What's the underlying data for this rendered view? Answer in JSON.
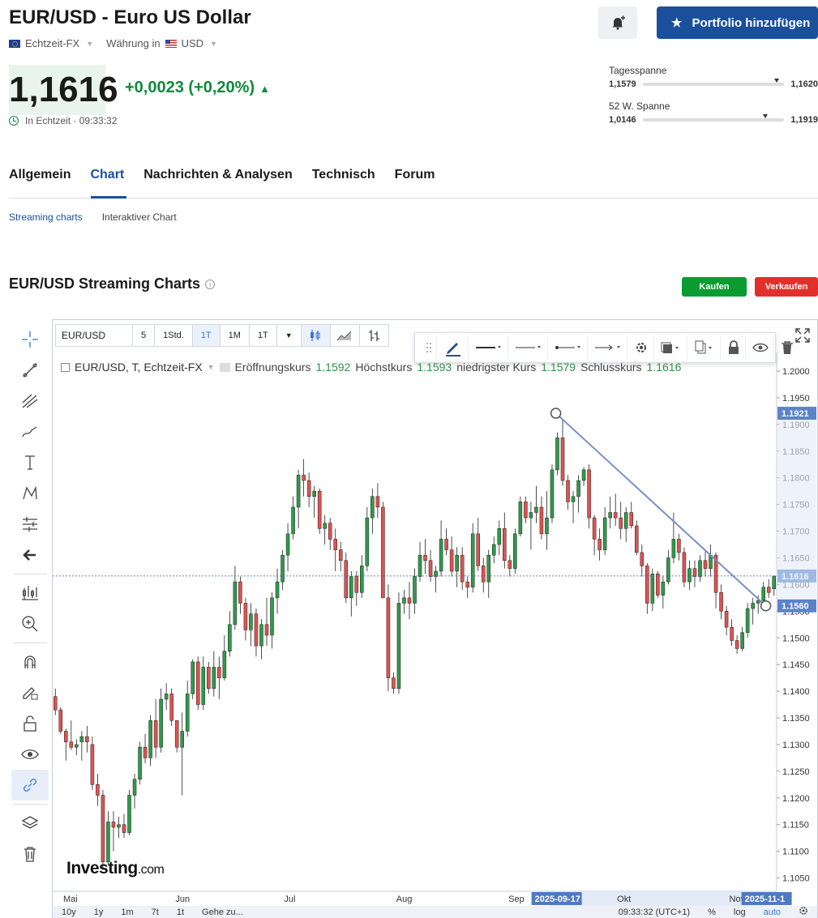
{
  "header": {
    "title": "EUR/USD - Euro US Dollar",
    "feed": "Echtzeit-FX",
    "currency_label": "Währung in",
    "currency": "USD",
    "price": "1,1616",
    "change": "+0,0023 (+0,20%)",
    "realtime_label": "In Echtzeit · 09:33:32",
    "portfolio_button": "Portfolio hinzufügen",
    "day_range": {
      "label": "Tagesspanne",
      "low": "1,1579",
      "high": "1,1620",
      "position": 0.93
    },
    "week52_range": {
      "label": "52 W. Spanne",
      "low": "1,0146",
      "high": "1,1919",
      "position": 0.85
    }
  },
  "tabs": [
    "Allgemein",
    "Chart",
    "Nachrichten & Analysen",
    "Technisch",
    "Forum"
  ],
  "active_tab": "Chart",
  "subtabs": [
    "Streaming charts",
    "Interaktiver Chart"
  ],
  "section_title": "EUR/USD Streaming Charts",
  "buttons": {
    "buy": "Kaufen",
    "sell": "Verkaufen"
  },
  "chart_toolbar": {
    "symbol": "EUR/USD",
    "intervals": [
      "5",
      "1Std.",
      "1T",
      "1M",
      "1T"
    ],
    "active_interval": "1T"
  },
  "legend": {
    "symbol": "EUR/USD, T, Echtzeit-FX",
    "open_label": "Eröffnungskurs",
    "open": "1.1592",
    "high_label": "Höchstkurs",
    "high": "1.1593",
    "low_label": "niedrigster Kurs",
    "low": "1.1579",
    "close_label": "Schlusskurs",
    "close": "1.1616"
  },
  "watermark": {
    "brand": "Investing",
    "suffix": ".com"
  },
  "bottom_bar": {
    "ranges": [
      "10y",
      "1y",
      "1m",
      "7t",
      "1t",
      "Gehe zu..."
    ],
    "time": "09:33:32 (UTC+1)",
    "options": [
      "%",
      "log",
      "auto"
    ]
  },
  "colors": {
    "up": "#2f9a4a",
    "down": "#e0524f",
    "brand_blue": "#1a4f9c",
    "trendline": "#7a8fc4",
    "positive": "#0f8a3b"
  },
  "chart_data": {
    "type": "candlestick",
    "y_ticks": [
      "1.2000",
      "1.1950",
      "1.1900",
      "1.1850",
      "1.1800",
      "1.1750",
      "1.1700",
      "1.1650",
      "1.1600",
      "1.1550",
      "1.1500",
      "1.1450",
      "1.1400",
      "1.1350",
      "1.1300",
      "1.1250",
      "1.1200",
      "1.1150",
      "1.1100",
      "1.1050"
    ],
    "ylim": [
      1.1025,
      1.2035
    ],
    "x_labels": [
      "Mai",
      "Jun",
      "Jul",
      "Aug",
      "Sep",
      "Okt",
      "Nov"
    ],
    "x_label_days": [
      0,
      31,
      61,
      92,
      123,
      153,
      184
    ],
    "x_range_days": [
      0,
      200
    ],
    "price_tags": [
      {
        "value": 1.1921,
        "label": "1.1921"
      },
      {
        "value": 1.1616,
        "label": "1.1616"
      },
      {
        "value": 1.156,
        "label": "1.1560"
      }
    ],
    "date_tags": [
      {
        "day": 139,
        "label": "2025-09-17"
      },
      {
        "day": 197,
        "label": "2025-11-1"
      }
    ],
    "last_price": 1.1616,
    "trendline": {
      "from": {
        "day": 139,
        "value": 1.1921
      },
      "to": {
        "day": 197,
        "value": 1.156
      }
    },
    "candles": [
      {
        "o": 1.139,
        "h": 1.1405,
        "l": 1.1355,
        "c": 1.1365
      },
      {
        "o": 1.1365,
        "h": 1.137,
        "l": 1.132,
        "c": 1.1325
      },
      {
        "o": 1.1325,
        "h": 1.133,
        "l": 1.127,
        "c": 1.1305
      },
      {
        "o": 1.1305,
        "h": 1.1345,
        "l": 1.129,
        "c": 1.1295
      },
      {
        "o": 1.1295,
        "h": 1.131,
        "l": 1.128,
        "c": 1.13
      },
      {
        "o": 1.1305,
        "h": 1.1325,
        "l": 1.127,
        "c": 1.1315
      },
      {
        "o": 1.1315,
        "h": 1.1335,
        "l": 1.1285,
        "c": 1.1305
      },
      {
        "o": 1.13,
        "h": 1.1315,
        "l": 1.1215,
        "c": 1.1225
      },
      {
        "o": 1.1225,
        "h": 1.1245,
        "l": 1.1185,
        "c": 1.1205
      },
      {
        "o": 1.1205,
        "h": 1.1215,
        "l": 1.1065,
        "c": 1.108
      },
      {
        "o": 1.108,
        "h": 1.1175,
        "l": 1.1075,
        "c": 1.1155
      },
      {
        "o": 1.1155,
        "h": 1.1175,
        "l": 1.11,
        "c": 1.1145
      },
      {
        "o": 1.1145,
        "h": 1.1165,
        "l": 1.1125,
        "c": 1.115
      },
      {
        "o": 1.115,
        "h": 1.117,
        "l": 1.1125,
        "c": 1.1135
      },
      {
        "o": 1.1135,
        "h": 1.1215,
        "l": 1.113,
        "c": 1.1205
      },
      {
        "o": 1.1205,
        "h": 1.1245,
        "l": 1.118,
        "c": 1.1235
      },
      {
        "o": 1.1235,
        "h": 1.1305,
        "l": 1.1225,
        "c": 1.1295
      },
      {
        "o": 1.1295,
        "h": 1.132,
        "l": 1.1265,
        "c": 1.1275
      },
      {
        "o": 1.1275,
        "h": 1.1355,
        "l": 1.126,
        "c": 1.1345
      },
      {
        "o": 1.1345,
        "h": 1.1385,
        "l": 1.1275,
        "c": 1.1295
      },
      {
        "o": 1.1295,
        "h": 1.1405,
        "l": 1.1285,
        "c": 1.1385
      },
      {
        "o": 1.1385,
        "h": 1.1415,
        "l": 1.1365,
        "c": 1.1395
      },
      {
        "o": 1.1395,
        "h": 1.1405,
        "l": 1.1335,
        "c": 1.1345
      },
      {
        "o": 1.1345,
        "h": 1.1335,
        "l": 1.1285,
        "c": 1.1295
      },
      {
        "o": 1.1295,
        "h": 1.136,
        "l": 1.1205,
        "c": 1.1325
      },
      {
        "o": 1.1325,
        "h": 1.142,
        "l": 1.1315,
        "c": 1.1395
      },
      {
        "o": 1.1395,
        "h": 1.146,
        "l": 1.1385,
        "c": 1.1455
      },
      {
        "o": 1.1455,
        "h": 1.1465,
        "l": 1.1365,
        "c": 1.1375
      },
      {
        "o": 1.1375,
        "h": 1.1465,
        "l": 1.1365,
        "c": 1.1445
      },
      {
        "o": 1.1445,
        "h": 1.1455,
        "l": 1.1395,
        "c": 1.1405
      },
      {
        "o": 1.1405,
        "h": 1.1475,
        "l": 1.139,
        "c": 1.1445
      },
      {
        "o": 1.1445,
        "h": 1.1465,
        "l": 1.1385,
        "c": 1.1425
      },
      {
        "o": 1.1425,
        "h": 1.1505,
        "l": 1.142,
        "c": 1.1475
      },
      {
        "o": 1.1475,
        "h": 1.155,
        "l": 1.1465,
        "c": 1.1525
      },
      {
        "o": 1.1525,
        "h": 1.1635,
        "l": 1.1515,
        "c": 1.1605
      },
      {
        "o": 1.1605,
        "h": 1.1615,
        "l": 1.1545,
        "c": 1.1565
      },
      {
        "o": 1.1565,
        "h": 1.1575,
        "l": 1.1495,
        "c": 1.1515
      },
      {
        "o": 1.1515,
        "h": 1.1565,
        "l": 1.1485,
        "c": 1.1545
      },
      {
        "o": 1.1545,
        "h": 1.1555,
        "l": 1.1465,
        "c": 1.1485
      },
      {
        "o": 1.1485,
        "h": 1.1535,
        "l": 1.146,
        "c": 1.1525
      },
      {
        "o": 1.1525,
        "h": 1.1575,
        "l": 1.1485,
        "c": 1.1505
      },
      {
        "o": 1.1505,
        "h": 1.1585,
        "l": 1.148,
        "c": 1.1575
      },
      {
        "o": 1.1575,
        "h": 1.163,
        "l": 1.1545,
        "c": 1.1605
      },
      {
        "o": 1.1605,
        "h": 1.1665,
        "l": 1.159,
        "c": 1.1655
      },
      {
        "o": 1.1655,
        "h": 1.1715,
        "l": 1.1625,
        "c": 1.1695
      },
      {
        "o": 1.1695,
        "h": 1.1765,
        "l": 1.1685,
        "c": 1.1745
      },
      {
        "o": 1.1745,
        "h": 1.1815,
        "l": 1.1705,
        "c": 1.1805
      },
      {
        "o": 1.1805,
        "h": 1.1835,
        "l": 1.1765,
        "c": 1.1795
      },
      {
        "o": 1.1795,
        "h": 1.181,
        "l": 1.1745,
        "c": 1.1765
      },
      {
        "o": 1.1765,
        "h": 1.1785,
        "l": 1.1725,
        "c": 1.1775
      },
      {
        "o": 1.1775,
        "h": 1.178,
        "l": 1.1695,
        "c": 1.1705
      },
      {
        "o": 1.1705,
        "h": 1.173,
        "l": 1.1675,
        "c": 1.1715
      },
      {
        "o": 1.1715,
        "h": 1.1725,
        "l": 1.1665,
        "c": 1.1685
      },
      {
        "o": 1.1685,
        "h": 1.1705,
        "l": 1.1625,
        "c": 1.1665
      },
      {
        "o": 1.1665,
        "h": 1.168,
        "l": 1.1625,
        "c": 1.1645
      },
      {
        "o": 1.1645,
        "h": 1.166,
        "l": 1.1565,
        "c": 1.1575
      },
      {
        "o": 1.1575,
        "h": 1.1625,
        "l": 1.154,
        "c": 1.1615
      },
      {
        "o": 1.1615,
        "h": 1.1625,
        "l": 1.156,
        "c": 1.1585
      },
      {
        "o": 1.1585,
        "h": 1.1655,
        "l": 1.1575,
        "c": 1.1635
      },
      {
        "o": 1.1635,
        "h": 1.1745,
        "l": 1.1625,
        "c": 1.1725
      },
      {
        "o": 1.1725,
        "h": 1.178,
        "l": 1.1695,
        "c": 1.1765
      },
      {
        "o": 1.1765,
        "h": 1.179,
        "l": 1.1725,
        "c": 1.1745
      },
      {
        "o": 1.1745,
        "h": 1.1755,
        "l": 1.16,
        "c": 1.1575
      },
      {
        "o": 1.1575,
        "h": 1.16,
        "l": 1.14,
        "c": 1.1425
      },
      {
        "o": 1.1425,
        "h": 1.1435,
        "l": 1.1395,
        "c": 1.1405
      },
      {
        "o": 1.1405,
        "h": 1.1585,
        "l": 1.1395,
        "c": 1.1565
      },
      {
        "o": 1.1565,
        "h": 1.159,
        "l": 1.1545,
        "c": 1.1575
      },
      {
        "o": 1.1575,
        "h": 1.1605,
        "l": 1.1535,
        "c": 1.1565
      },
      {
        "o": 1.1565,
        "h": 1.163,
        "l": 1.1545,
        "c": 1.1615
      },
      {
        "o": 1.1615,
        "h": 1.168,
        "l": 1.1605,
        "c": 1.1655
      },
      {
        "o": 1.1655,
        "h": 1.1685,
        "l": 1.162,
        "c": 1.1645
      },
      {
        "o": 1.1645,
        "h": 1.1665,
        "l": 1.1605,
        "c": 1.1615
      },
      {
        "o": 1.1615,
        "h": 1.1635,
        "l": 1.1585,
        "c": 1.1625
      },
      {
        "o": 1.1625,
        "h": 1.172,
        "l": 1.1615,
        "c": 1.1685
      },
      {
        "o": 1.1685,
        "h": 1.1705,
        "l": 1.1655,
        "c": 1.1665
      },
      {
        "o": 1.1665,
        "h": 1.169,
        "l": 1.1615,
        "c": 1.1625
      },
      {
        "o": 1.1625,
        "h": 1.167,
        "l": 1.1595,
        "c": 1.1655
      },
      {
        "o": 1.1655,
        "h": 1.167,
        "l": 1.159,
        "c": 1.1605
      },
      {
        "o": 1.1605,
        "h": 1.1615,
        "l": 1.1575,
        "c": 1.1595
      },
      {
        "o": 1.1595,
        "h": 1.1715,
        "l": 1.1585,
        "c": 1.1695
      },
      {
        "o": 1.1695,
        "h": 1.1725,
        "l": 1.1625,
        "c": 1.1635
      },
      {
        "o": 1.1635,
        "h": 1.165,
        "l": 1.1585,
        "c": 1.1605
      },
      {
        "o": 1.1605,
        "h": 1.1665,
        "l": 1.1575,
        "c": 1.1655
      },
      {
        "o": 1.1655,
        "h": 1.169,
        "l": 1.164,
        "c": 1.1675
      },
      {
        "o": 1.1675,
        "h": 1.172,
        "l": 1.1655,
        "c": 1.1705
      },
      {
        "o": 1.1705,
        "h": 1.1735,
        "l": 1.163,
        "c": 1.1645
      },
      {
        "o": 1.1645,
        "h": 1.1655,
        "l": 1.1615,
        "c": 1.163
      },
      {
        "o": 1.163,
        "h": 1.1705,
        "l": 1.162,
        "c": 1.1695
      },
      {
        "o": 1.1695,
        "h": 1.1765,
        "l": 1.169,
        "c": 1.1755
      },
      {
        "o": 1.1755,
        "h": 1.1765,
        "l": 1.1715,
        "c": 1.1725
      },
      {
        "o": 1.1725,
        "h": 1.1755,
        "l": 1.1665,
        "c": 1.1735
      },
      {
        "o": 1.1735,
        "h": 1.1785,
        "l": 1.1715,
        "c": 1.1745
      },
      {
        "o": 1.1745,
        "h": 1.1765,
        "l": 1.1685,
        "c": 1.1695
      },
      {
        "o": 1.1695,
        "h": 1.1775,
        "l": 1.1665,
        "c": 1.1725
      },
      {
        "o": 1.1725,
        "h": 1.1825,
        "l": 1.1715,
        "c": 1.1815
      },
      {
        "o": 1.1815,
        "h": 1.1885,
        "l": 1.1805,
        "c": 1.1875
      },
      {
        "o": 1.1875,
        "h": 1.191,
        "l": 1.1785,
        "c": 1.1795
      },
      {
        "o": 1.1795,
        "h": 1.1805,
        "l": 1.174,
        "c": 1.1755
      },
      {
        "o": 1.1755,
        "h": 1.1775,
        "l": 1.1715,
        "c": 1.1765
      },
      {
        "o": 1.1765,
        "h": 1.1805,
        "l": 1.1735,
        "c": 1.1795
      },
      {
        "o": 1.1795,
        "h": 1.182,
        "l": 1.1785,
        "c": 1.1815
      },
      {
        "o": 1.1815,
        "h": 1.1825,
        "l": 1.1705,
        "c": 1.1725
      },
      {
        "o": 1.1725,
        "h": 1.173,
        "l": 1.1655,
        "c": 1.1685
      },
      {
        "o": 1.1685,
        "h": 1.1705,
        "l": 1.1645,
        "c": 1.1665
      },
      {
        "o": 1.1665,
        "h": 1.1745,
        "l": 1.1655,
        "c": 1.1725
      },
      {
        "o": 1.1725,
        "h": 1.1765,
        "l": 1.1705,
        "c": 1.1735
      },
      {
        "o": 1.1735,
        "h": 1.177,
        "l": 1.171,
        "c": 1.1725
      },
      {
        "o": 1.1725,
        "h": 1.1755,
        "l": 1.1685,
        "c": 1.1705
      },
      {
        "o": 1.1705,
        "h": 1.1745,
        "l": 1.168,
        "c": 1.1735
      },
      {
        "o": 1.1735,
        "h": 1.1755,
        "l": 1.1705,
        "c": 1.171
      },
      {
        "o": 1.171,
        "h": 1.172,
        "l": 1.1655,
        "c": 1.166
      },
      {
        "o": 1.166,
        "h": 1.1675,
        "l": 1.1615,
        "c": 1.1635
      },
      {
        "o": 1.1635,
        "h": 1.164,
        "l": 1.1545,
        "c": 1.1565
      },
      {
        "o": 1.1565,
        "h": 1.163,
        "l": 1.155,
        "c": 1.162
      },
      {
        "o": 1.162,
        "h": 1.1625,
        "l": 1.1575,
        "c": 1.158
      },
      {
        "o": 1.158,
        "h": 1.1615,
        "l": 1.1555,
        "c": 1.1605
      },
      {
        "o": 1.1605,
        "h": 1.1665,
        "l": 1.16,
        "c": 1.165
      },
      {
        "o": 1.165,
        "h": 1.1735,
        "l": 1.164,
        "c": 1.1685
      },
      {
        "o": 1.1685,
        "h": 1.1695,
        "l": 1.1645,
        "c": 1.166
      },
      {
        "o": 1.166,
        "h": 1.167,
        "l": 1.1595,
        "c": 1.1605
      },
      {
        "o": 1.1605,
        "h": 1.1645,
        "l": 1.159,
        "c": 1.163
      },
      {
        "o": 1.163,
        "h": 1.1645,
        "l": 1.1595,
        "c": 1.1615
      },
      {
        "o": 1.1615,
        "h": 1.1655,
        "l": 1.1605,
        "c": 1.1645
      },
      {
        "o": 1.1645,
        "h": 1.1665,
        "l": 1.1615,
        "c": 1.163
      },
      {
        "o": 1.163,
        "h": 1.1675,
        "l": 1.1615,
        "c": 1.1655
      },
      {
        "o": 1.1655,
        "h": 1.166,
        "l": 1.1555,
        "c": 1.1585
      },
      {
        "o": 1.1585,
        "h": 1.16,
        "l": 1.1535,
        "c": 1.155
      },
      {
        "o": 1.155,
        "h": 1.156,
        "l": 1.1505,
        "c": 1.152
      },
      {
        "o": 1.152,
        "h": 1.1535,
        "l": 1.1485,
        "c": 1.1495
      },
      {
        "o": 1.1495,
        "h": 1.1505,
        "l": 1.147,
        "c": 1.148
      },
      {
        "o": 1.148,
        "h": 1.152,
        "l": 1.1475,
        "c": 1.151
      },
      {
        "o": 1.151,
        "h": 1.1565,
        "l": 1.15,
        "c": 1.1555
      },
      {
        "o": 1.1555,
        "h": 1.1575,
        "l": 1.1525,
        "c": 1.1565
      },
      {
        "o": 1.1565,
        "h": 1.158,
        "l": 1.1545,
        "c": 1.157
      },
      {
        "o": 1.157,
        "h": 1.1605,
        "l": 1.1555,
        "c": 1.1595
      },
      {
        "o": 1.1595,
        "h": 1.161,
        "l": 1.1575,
        "c": 1.1585
      },
      {
        "o": 1.1592,
        "h": 1.1593,
        "l": 1.1579,
        "c": 1.1616
      }
    ]
  }
}
